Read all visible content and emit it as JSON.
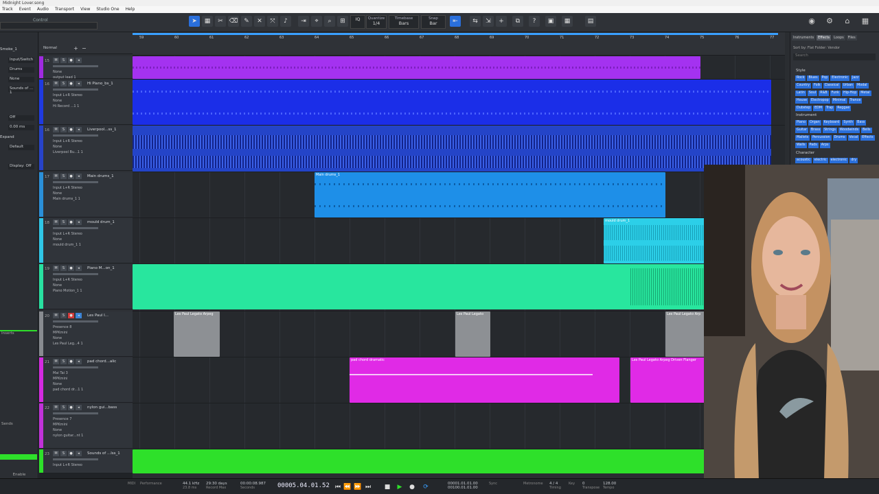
{
  "window": {
    "title": "Midnight Lover.song"
  },
  "menu": [
    "Track",
    "Event",
    "Audio",
    "Transport",
    "View",
    "Studio One",
    "Help"
  ],
  "toolbar": {
    "control_label": "Control",
    "quantize": {
      "label": "Quantize",
      "value": "1/4"
    },
    "timebase": {
      "label": "Timebase",
      "value": "Bars"
    },
    "snap": {
      "label": "Snap",
      "value": "Bar"
    },
    "iq": "IQ"
  },
  "inspector": {
    "track_name": "Smoke_1",
    "rows": [
      "Input/Switch",
      "Drums",
      "None",
      "Sounds of ... 1",
      "Off",
      "0.00 ms",
      "Expand",
      "Default",
      "Display: Off"
    ],
    "inserts_label": "Inserts",
    "sends_label": "Sends",
    "bottom_label": "Enable"
  },
  "tracklist": {
    "header_label": "Normal",
    "tracks": [
      {
        "num": "15",
        "name": "",
        "io": [
          "None",
          "output lead 1"
        ],
        "color": "#a02ae0"
      },
      {
        "num": "16",
        "name": "Hi Piano_bs_1",
        "io": [
          "Input L+R  Stereo",
          "None",
          "Hi Record ...1 1"
        ],
        "color": "#1f3ae0"
      },
      {
        "num": "16",
        "name": "Liverpool...ss_1",
        "io": [
          "Input L+R  Stereo",
          "None",
          "Liverpool Bu...1 1"
        ],
        "color": "#2743c9"
      },
      {
        "num": "17",
        "name": "Main drums_1",
        "io": [
          "Input L+R  Stereo",
          "None",
          "Main drums_1 1"
        ],
        "color": "#2a8fd8"
      },
      {
        "num": "18",
        "name": "mould drum_1",
        "io": [
          "Input L+R  Stereo",
          "None",
          "mould drum_1 1"
        ],
        "color": "#2fc6e6"
      },
      {
        "num": "19",
        "name": "Piano M...on_1",
        "io": [
          "Input L+R  Stereo",
          "None",
          "Piano Motion_1 1"
        ],
        "color": "#28e0a0"
      },
      {
        "num": "20",
        "name": "Les Paul I...",
        "io": [
          "Presence 8",
          "MPKmini",
          "None",
          "Les Paul Leg...4 1"
        ],
        "color": "#888b90"
      },
      {
        "num": "21",
        "name": "pad chord...alic",
        "io": [
          "Mai Tai 3",
          "MPKmini",
          "None",
          "pad chord dr...1 1"
        ],
        "color": "#d42ae0"
      },
      {
        "num": "22",
        "name": "nylon gui...bass",
        "io": [
          "Presence 7",
          "MPKmini",
          "None",
          "nylon guitar...nt 1"
        ],
        "color": "#c032d8"
      },
      {
        "num": "23",
        "name": "Sounds of ...lss_1",
        "io": [
          "Input L+R  Stereo"
        ],
        "color": "#2ee02a"
      }
    ]
  },
  "ruler": {
    "marks": [
      "59",
      "60",
      "61",
      "62",
      "63",
      "64",
      "65",
      "66",
      "67",
      "68",
      "69",
      "70",
      "71",
      "72",
      "73",
      "74",
      "75",
      "76",
      "77"
    ]
  },
  "events": [
    {
      "name": "Main drums_1",
      "color": "#1e8fe8"
    },
    {
      "name": "mould drum_1",
      "color": "#2ccfe8"
    },
    {
      "name": "Les Paul Legato Arpeg",
      "color": "#8d9094"
    },
    {
      "name": "Les Paul Legato",
      "color": "#8d9094"
    },
    {
      "name": "Les Paul Legato Arp",
      "color": "#8d9094"
    },
    {
      "name": "pad chord dramatic",
      "color": "#e02ae6"
    },
    {
      "name": "Les Paul Legato Arpeg Driven Flanger",
      "color": "#e02ae6"
    }
  ],
  "browser": {
    "tabs": [
      "Instruments",
      "Effects",
      "Loops",
      "Files"
    ],
    "filter": {
      "sort": "Sort by:",
      "folder": "Flat",
      "vendor": "Folder: Vendor"
    },
    "search_placeholder": "Search",
    "style_label": "Style",
    "style_tags": [
      "Rock",
      "Blues",
      "Pop",
      "Electronic",
      "Jazz",
      "Country",
      "Folk",
      "Classical",
      "Urban",
      "Modal",
      "Latin",
      "Soul",
      "R&B",
      "Funk",
      "Hip-Hop",
      "Metal",
      "House",
      "Electropop",
      "Minimal",
      "Trance",
      "Dubstep",
      "EDM",
      "Trap",
      "Reggae"
    ],
    "instrument_label": "Instrument",
    "instrument_tags": [
      "Piano",
      "Organ",
      "Keyboard",
      "Synth",
      "Bass",
      "Guitar",
      "Brass",
      "Strings",
      "Woodwinds",
      "Bells",
      "Mallets",
      "Percussion",
      "Drums",
      "Vocal",
      "Effects",
      "Walls",
      "Pads",
      "Arps"
    ],
    "character_label": "Character",
    "character_tags": [
      "acoustic",
      "electric",
      "electronic",
      "dry"
    ]
  },
  "transport": {
    "midi_label": "MIDI",
    "performance_label": "Performance",
    "sample_rate": "44.1 kHz",
    "rate_sub": "23.8 ms",
    "record_max": "29:30 days",
    "record_max_label": "Record Max",
    "seconds": "00:00:08.987",
    "seconds_label": "Seconds",
    "bars": "00005.04.01.52",
    "bars_label": "Bars",
    "loop_start": "00001.01.01.00",
    "loop_end": "00100.01.01.00",
    "sync": "Sync",
    "metronome": "Metronome",
    "timing": "Timing",
    "key": "Key",
    "signature": "4 / 4",
    "transpose": "0",
    "transpose_label": "Transpose",
    "tempo": "128.00",
    "tempo_label": "Tempo"
  },
  "colors": {
    "accent": "#2a6fdb",
    "loop": "#3aa0ff"
  }
}
